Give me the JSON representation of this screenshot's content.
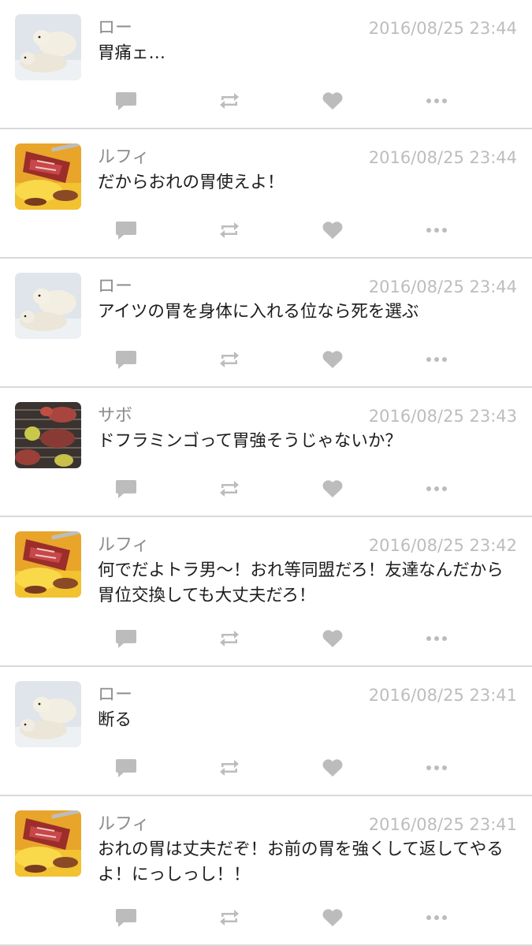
{
  "feed": {
    "posts": [
      {
        "name": "ロー",
        "time": "2016/08/25 23:44",
        "text": "胃痛ェ…",
        "avatar_icon": "polar-bear-avatar"
      },
      {
        "name": "ルフィ",
        "time": "2016/08/25 23:44",
        "text": "だからおれの胃使えよ！",
        "avatar_icon": "grilled-meat-avatar"
      },
      {
        "name": "ロー",
        "time": "2016/08/25 23:44",
        "text": "アイツの胃を身体に入れる位なら死を選ぶ",
        "avatar_icon": "polar-bear-avatar"
      },
      {
        "name": "サボ",
        "time": "2016/08/25 23:43",
        "text": "ドフラミンゴって胃強そうじゃないか？",
        "avatar_icon": "yakiniku-plate-avatar"
      },
      {
        "name": "ルフィ",
        "time": "2016/08/25 23:42",
        "text": "何でだよトラ男〜！おれ等同盟だろ！友達なんだから胃位交換しても大丈夫だろ！",
        "avatar_icon": "grilled-meat-avatar"
      },
      {
        "name": "ロー",
        "time": "2016/08/25 23:41",
        "text": "断る",
        "avatar_icon": "polar-bear-avatar"
      },
      {
        "name": "ルフィ",
        "time": "2016/08/25 23:41",
        "text": "おれの胃は丈夫だぞ！お前の胃を強くして返してやるよ！にっしっし！！",
        "avatar_icon": "grilled-meat-avatar"
      }
    ]
  },
  "colors": {
    "icon": "#bcbcbc",
    "name": "#8c8c8c",
    "time": "#bdbdbd",
    "text": "#1c1c1c",
    "divider": "#d9d9d9"
  }
}
